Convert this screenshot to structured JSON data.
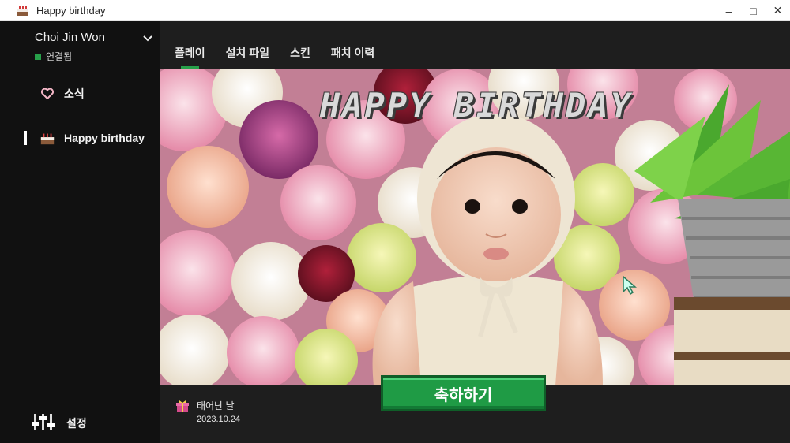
{
  "window": {
    "title": "Happy birthday"
  },
  "account": {
    "name": "Choi Jin Won",
    "status": "연결됨"
  },
  "sidebar": {
    "items": [
      {
        "label": "소식",
        "icon": "heart-icon"
      },
      {
        "label": "Happy birthday",
        "icon": "cake-icon"
      }
    ],
    "settings_label": "설정"
  },
  "tabs": [
    {
      "label": "플레이"
    },
    {
      "label": "설치 파일"
    },
    {
      "label": "스킨"
    },
    {
      "label": "패치 이력"
    }
  ],
  "hero": {
    "title": "HAPPY BIRTHDAY"
  },
  "footer": {
    "birthday_label": "태어난 날",
    "birthday_date": "2023.10.24",
    "celebrate_label": "축하하기"
  },
  "colors": {
    "accent": "#27a04a",
    "sidebar_bg": "#111111",
    "main_bg": "#1e1e1e"
  }
}
